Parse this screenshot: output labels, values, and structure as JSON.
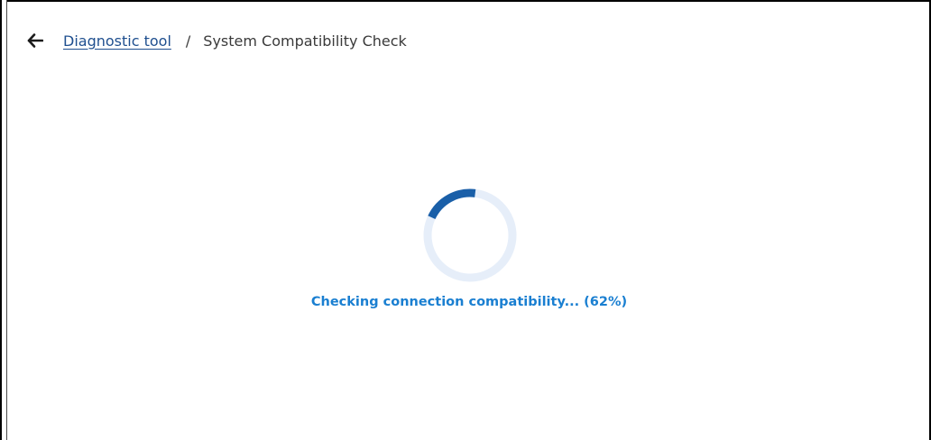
{
  "breadcrumb": {
    "back_icon": "arrow-left-icon",
    "parent_label": "Diagnostic tool",
    "separator": "/",
    "current_label": "System Compatibility Check"
  },
  "progress": {
    "status_text": "Checking connection compatibility... (62%)",
    "percent": 62,
    "spinner_arc_fraction": 0.2,
    "colors": {
      "arc": "#1a5fa8",
      "track": "#e6eef9",
      "status_text": "#1a7fd1",
      "link": "#1f4f8f"
    }
  }
}
